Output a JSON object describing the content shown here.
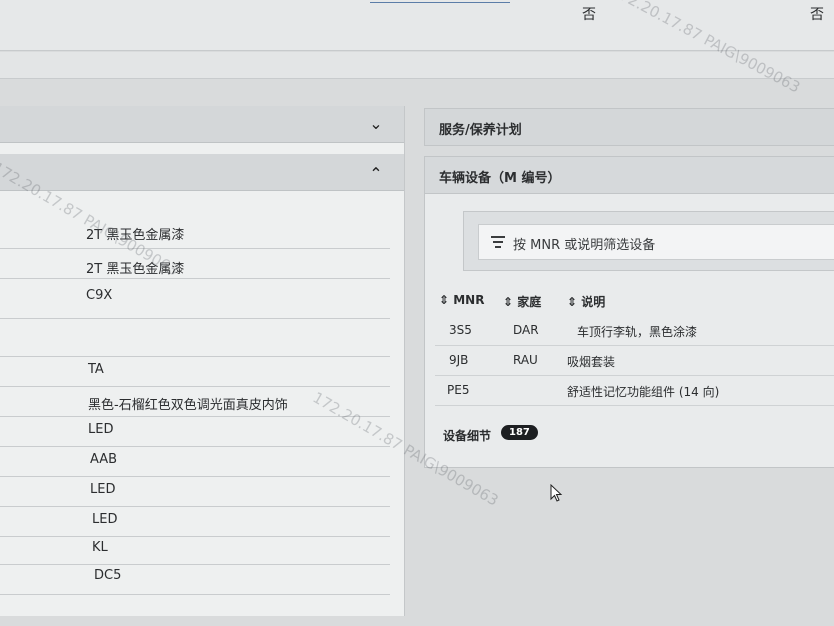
{
  "top": {
    "value_left": "否",
    "value_right": "否"
  },
  "left_panel": {
    "rows": [
      "2T 黑玉色金属漆",
      "2T 黑玉色金属漆",
      "C9X",
      "",
      "TA",
      "黑色-石榴红色双色调光面真皮内饰",
      "LED",
      "AAB",
      "LED",
      "LED",
      "KL",
      "DC5"
    ]
  },
  "service_card": {
    "title": "服务/保养计划"
  },
  "equipment": {
    "title": "车辆设备（M 编号）",
    "filter_placeholder": "按 MNR 或说明筛选设备",
    "columns": [
      "MNR",
      "家庭",
      "说明"
    ],
    "rows": [
      {
        "mnr": "3S5",
        "family": "DAR",
        "desc": "车顶行李轨，黑色涂漆"
      },
      {
        "mnr": "9JB",
        "family": "RAU",
        "desc": "吸烟套装"
      },
      {
        "mnr": "PE5",
        "family": "",
        "desc": "舒适性记忆功能组件 (14 向)"
      }
    ],
    "detail_label": "设备细节",
    "detail_count": "187"
  },
  "watermark": "172.20.17.87 PAIG\\9009063"
}
